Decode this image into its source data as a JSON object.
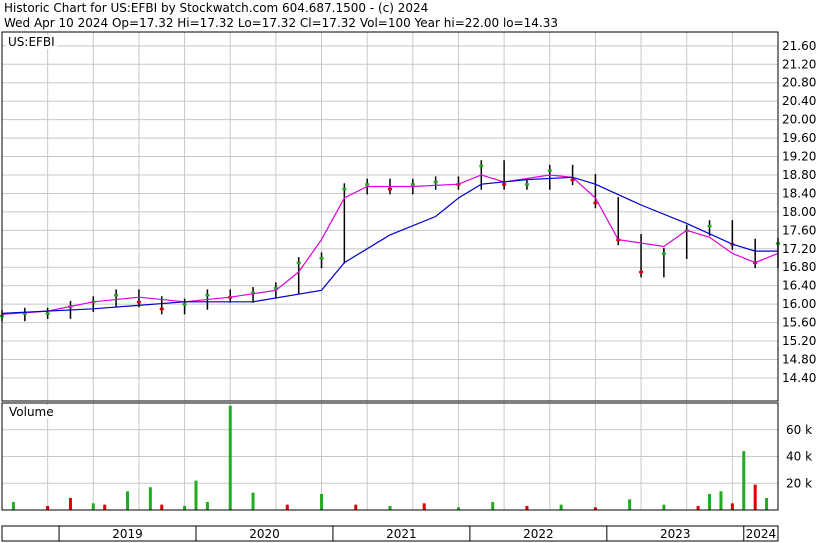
{
  "header": {
    "line1": "Historic Chart for US:EFBI by Stockwatch.com 604.687.1500 - (c) 2024",
    "line2": "Wed Apr 10 2024   Op=17.32  Hi=17.32  Lo=17.32  Cl=17.32  Vol=100   Year hi=22.00  lo=14.33"
  },
  "panels": {
    "price_label": "US:EFBI",
    "volume_label": "Volume"
  },
  "colors": {
    "up": "#22aa22",
    "down": "#dd0000",
    "ma_short": "#dd00dd",
    "ma_long": "#0000cc",
    "grid": "#c8c8c8",
    "bar": "#000000"
  },
  "chart_data": [
    {
      "type": "line",
      "title": "US:EFBI",
      "y_axis": {
        "side": "right",
        "ylim": [
          13.9,
          21.9
        ],
        "ticks": [
          "14.40",
          "14.80",
          "15.20",
          "15.60",
          "16.00",
          "16.40",
          "16.80",
          "17.20",
          "17.60",
          "18.00",
          "18.40",
          "18.80",
          "19.20",
          "19.60",
          "20.00",
          "20.40",
          "20.80",
          "21.20",
          "21.60"
        ]
      },
      "x_axis": {
        "labels": [
          "2019",
          "2020",
          "2021",
          "2022",
          "2023",
          "2024"
        ],
        "xlim": [
          "2018-08",
          "2024-04"
        ]
      },
      "grid": true,
      "series": [
        {
          "kind": "price",
          "x": [
            "2018-08",
            "2018-10",
            "2018-12",
            "2019-02",
            "2019-04",
            "2019-06",
            "2019-08",
            "2019-10",
            "2019-12",
            "2020-02",
            "2020-04",
            "2020-06",
            "2020-08",
            "2020-10",
            "2020-12",
            "2021-02",
            "2021-04",
            "2021-06",
            "2021-08",
            "2021-10",
            "2021-12",
            "2022-02",
            "2022-04",
            "2022-06",
            "2022-08",
            "2022-10",
            "2022-12",
            "2023-02",
            "2023-04",
            "2023-06",
            "2023-08",
            "2023-10",
            "2023-12",
            "2024-02",
            "2024-04"
          ],
          "y": [
            15.75,
            15.8,
            15.8,
            15.95,
            16.05,
            16.2,
            16.05,
            15.9,
            16.0,
            16.2,
            16.15,
            16.25,
            16.35,
            16.9,
            17.0,
            18.5,
            18.6,
            18.5,
            18.6,
            18.65,
            18.6,
            19.0,
            18.6,
            18.6,
            18.9,
            18.7,
            18.2,
            17.4,
            16.7,
            17.1,
            17.6,
            17.7,
            17.3,
            16.9,
            17.32
          ]
        },
        {
          "kind": "ma_short",
          "x": [
            "2018-08",
            "2018-12",
            "2019-04",
            "2019-08",
            "2019-12",
            "2020-04",
            "2020-08",
            "2020-10",
            "2020-12",
            "2021-02",
            "2021-04",
            "2021-08",
            "2021-12",
            "2022-02",
            "2022-04",
            "2022-08",
            "2022-10",
            "2022-12",
            "2023-02",
            "2023-06",
            "2023-08",
            "2023-10",
            "2023-12",
            "2024-02",
            "2024-04"
          ],
          "y": [
            15.78,
            15.85,
            16.05,
            16.15,
            16.05,
            16.15,
            16.3,
            16.7,
            17.4,
            18.3,
            18.55,
            18.55,
            18.6,
            18.8,
            18.65,
            18.8,
            18.75,
            18.3,
            17.4,
            17.25,
            17.6,
            17.45,
            17.1,
            16.9,
            17.1
          ]
        },
        {
          "kind": "ma_long",
          "x": [
            "2018-08",
            "2019-04",
            "2019-12",
            "2020-06",
            "2020-12",
            "2021-02",
            "2021-06",
            "2021-10",
            "2021-12",
            "2022-02",
            "2022-06",
            "2022-10",
            "2022-12",
            "2023-04",
            "2023-08",
            "2023-12",
            "2024-02",
            "2024-04"
          ],
          "y": [
            15.8,
            15.9,
            16.05,
            16.05,
            16.3,
            16.9,
            17.5,
            17.9,
            18.3,
            18.6,
            18.7,
            18.75,
            18.6,
            18.15,
            17.75,
            17.3,
            17.15,
            17.15
          ]
        }
      ]
    },
    {
      "type": "bar",
      "title": "Volume",
      "y_axis": {
        "side": "right",
        "ylim": [
          0,
          80000
        ],
        "ticks": [
          "20 k",
          "40 k",
          "60 k"
        ]
      },
      "x": [
        "2018-09",
        "2018-12",
        "2019-02",
        "2019-04",
        "2019-05",
        "2019-07",
        "2019-09",
        "2019-10",
        "2019-12",
        "2020-01",
        "2020-02",
        "2020-04",
        "2020-06",
        "2020-09",
        "2020-12",
        "2021-03",
        "2021-06",
        "2021-09",
        "2021-12",
        "2022-03",
        "2022-06",
        "2022-09",
        "2022-12",
        "2023-03",
        "2023-06",
        "2023-09",
        "2023-10",
        "2023-11",
        "2023-12",
        "2024-01",
        "2024-02",
        "2024-03"
      ],
      "values": [
        6000,
        3000,
        9000,
        5000,
        4000,
        14000,
        17000,
        4000,
        3000,
        22000,
        6000,
        78000,
        13000,
        4000,
        12000,
        4000,
        3000,
        5000,
        2000,
        6000,
        3000,
        4000,
        2000,
        8000,
        4000,
        3000,
        12000,
        14000,
        5000,
        44000,
        19000,
        9000
      ],
      "direction": [
        "up",
        "down",
        "down",
        "up",
        "down",
        "up",
        "up",
        "down",
        "up",
        "up",
        "up",
        "up",
        "up",
        "down",
        "up",
        "down",
        "up",
        "down",
        "up",
        "up",
        "down",
        "up",
        "down",
        "up",
        "up",
        "down",
        "up",
        "up",
        "down",
        "up",
        "down",
        "up"
      ]
    }
  ]
}
